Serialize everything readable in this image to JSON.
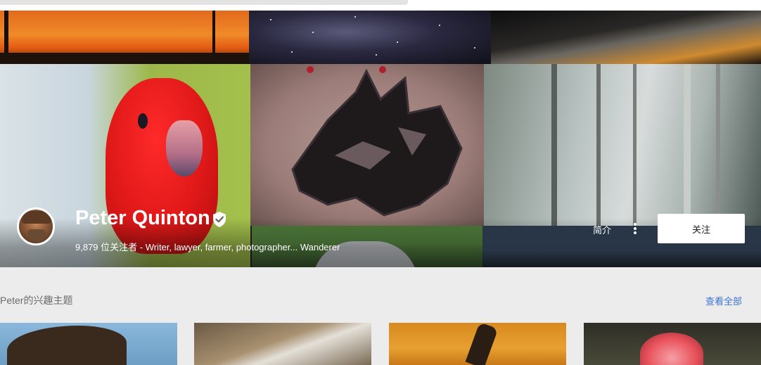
{
  "profile": {
    "name": "Peter Quinton",
    "subtitle": "9,879 位关注者 - Writer, lawyer, farmer, photographer... Wanderer",
    "about_label": "简介",
    "follow_label": "关注"
  },
  "interests": {
    "title": "Peter的兴趣主题",
    "view_all_label": "查看全部"
  },
  "icons": {
    "verified": "verified-check-icon",
    "more": "more-vertical-icon"
  },
  "colors": {
    "link": "#3d74d6",
    "page_background": "#ececec"
  }
}
